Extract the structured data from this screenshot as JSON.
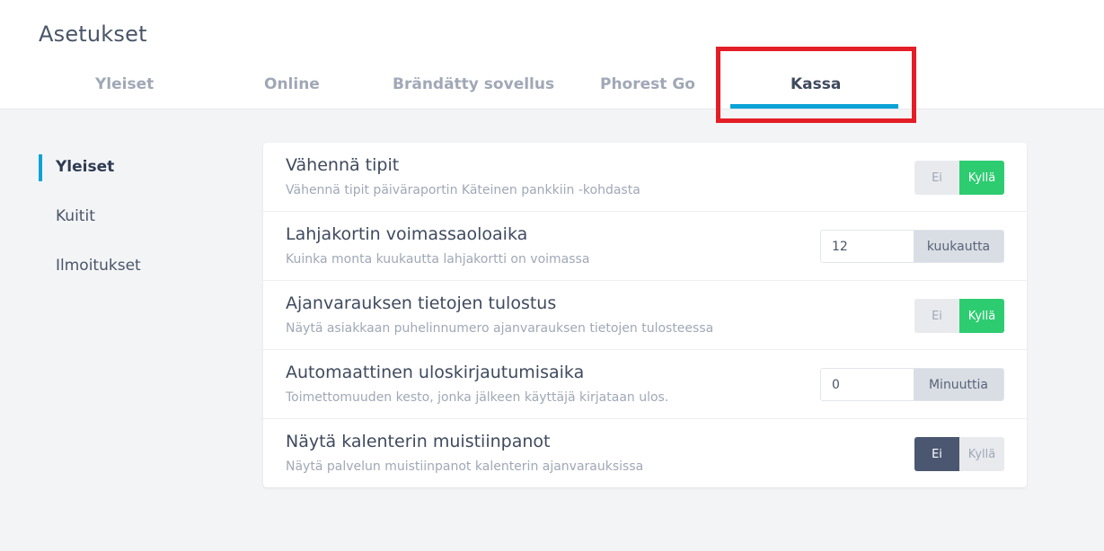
{
  "header": {
    "title": "Asetukset",
    "tabs": [
      {
        "label": "Yleiset"
      },
      {
        "label": "Online"
      },
      {
        "label": "Brändätty sovellus"
      },
      {
        "label": "Phorest Go"
      },
      {
        "label": "Kassa"
      }
    ],
    "active_tab": "Kassa"
  },
  "sidebar": {
    "items": [
      {
        "label": "Yleiset"
      },
      {
        "label": "Kuitit"
      },
      {
        "label": "Ilmoitukset"
      }
    ],
    "active": "Yleiset"
  },
  "settings": [
    {
      "title": "Vähennä tipit",
      "description": "Vähennä tipit päiväraportin Käteinen pankkiin -kohdasta",
      "control": "toggle",
      "off_label": "Ei",
      "on_label": "Kyllä",
      "selected": "Kyllä"
    },
    {
      "title": "Lahjakortin voimassaoloaika",
      "description": "Kuinka monta kuukautta lahjakortti on voimassa",
      "control": "number",
      "value": "12",
      "unit": "kuukautta"
    },
    {
      "title": "Ajanvarauksen tietojen tulostus",
      "description": "Näytä asiakkaan puhelinnumero ajanvarauksen tietojen tulosteessa",
      "control": "toggle",
      "off_label": "Ei",
      "on_label": "Kyllä",
      "selected": "Kyllä"
    },
    {
      "title": "Automaattinen uloskirjautumisaika",
      "description": "Toimettomuuden kesto, jonka jälkeen käyttäjä kirjataan ulos.",
      "control": "number",
      "value": "0",
      "unit": "Minuuttia"
    },
    {
      "title": "Näytä kalenterin muistiinpanot",
      "description": "Näytä palvelun muistiinpanot kalenterin ajanvarauksissa",
      "control": "toggle",
      "off_label": "Ei",
      "on_label": "Kyllä",
      "selected": "Ei"
    }
  ],
  "colors": {
    "accent": "#0aa3d6",
    "toggle_on": "#2ecc71",
    "toggle_off_selected": "#4b5770",
    "highlight": "#e41e26"
  }
}
